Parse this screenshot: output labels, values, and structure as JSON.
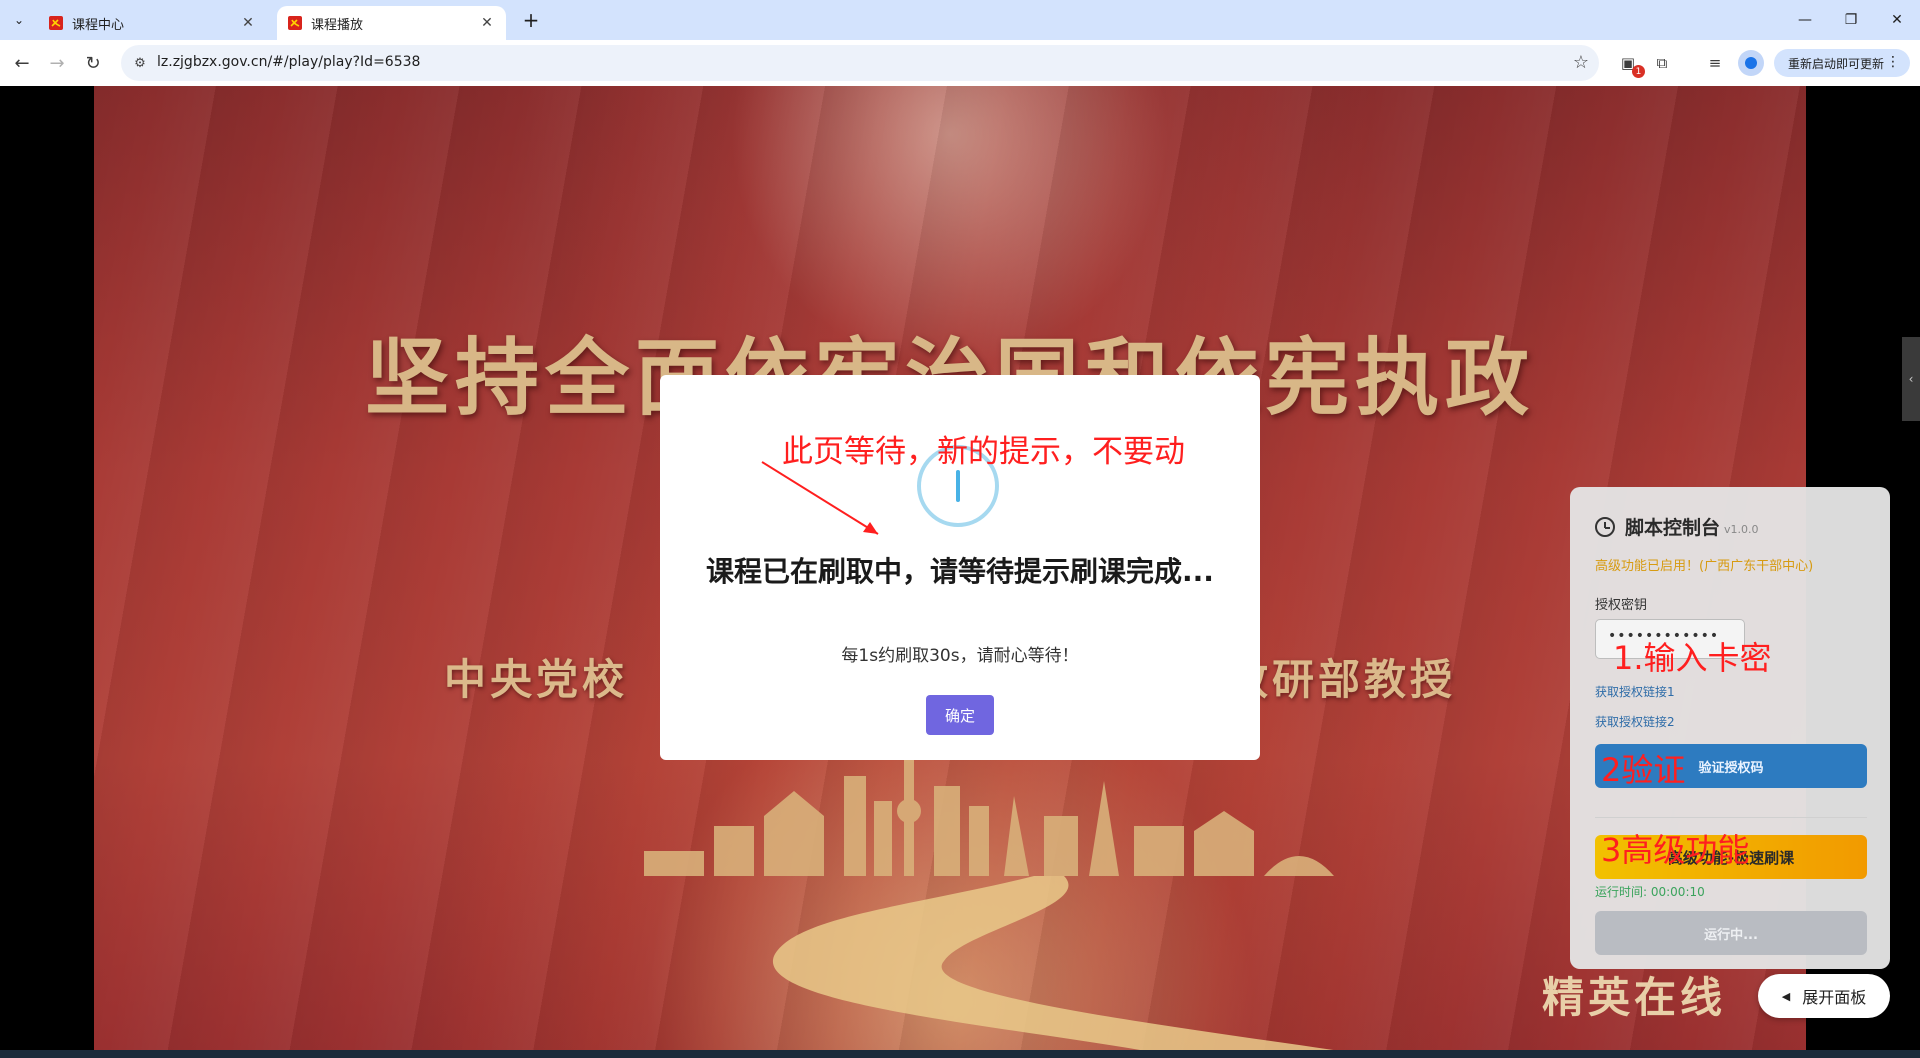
{
  "browser": {
    "tabs": [
      {
        "title": "课程中心",
        "active": false
      },
      {
        "title": "课程播放",
        "active": true
      }
    ],
    "url": "lz.zjgbzx.gov.cn/#/play/play?Id=6538",
    "extension_badge": "1",
    "update_button": "重新启动即可更新"
  },
  "video": {
    "title_text": "坚持全面依宪治国和依宪执政",
    "subtitle_text": "中央党校　　　　　　　　　　　　　教研部教授",
    "brand": "精英在线"
  },
  "modal": {
    "title": "课程已在刷取中，请等待提示刷课完成...",
    "text": "每1s约刷取30s，请耐心等待！",
    "ok_label": "确定"
  },
  "annotations": {
    "top": "此页等待，新的提示，不要动",
    "step1": "1.输入卡密",
    "step2": "2验证",
    "step3": "3高级功能"
  },
  "panel": {
    "title": "脚本控制台",
    "version": "v1.0.0",
    "note": "高级功能已启用！(广西广东干部中心)",
    "auth_label": "授权密钥",
    "auth_value": "••••••••••••",
    "link1": "获取授权链接1",
    "link2": "获取授权链接2",
    "verify_label": "验证授权码",
    "advanced_label": "高级功能-极速刷课",
    "runtime": "运行时间: 00:00:10",
    "running_label": "运行中..."
  },
  "expand_panel_label": "展开面板",
  "colors": {
    "accent_modal_button": "#7066e0",
    "verify_button": "#2d7bc0",
    "advanced_button": "#f2b100",
    "annotation_red": "#ff1f1f"
  }
}
